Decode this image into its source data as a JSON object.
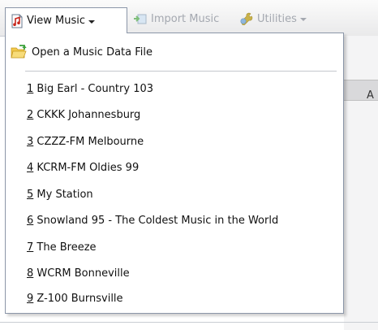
{
  "toolbar": {
    "view_music_label": "View Music",
    "import_music_label": "Import Music",
    "utilities_label": "Utilities"
  },
  "menu": {
    "open_file_label": "Open a Music Data File",
    "stations": [
      {
        "num": "1",
        "name": " Big Earl - Country 103"
      },
      {
        "num": "2",
        "name": " CKKK Johannesburg"
      },
      {
        "num": "3",
        "name": " CZZZ-FM Melbourne"
      },
      {
        "num": "4",
        "name": " KCRM-FM Oldies 99"
      },
      {
        "num": "5",
        "name": " My Station"
      },
      {
        "num": "6",
        "name": " Snowland 95 - The Coldest Music in the World"
      },
      {
        "num": "7",
        "name": " The Breeze"
      },
      {
        "num": "8",
        "name": " WCRM Bonneville"
      },
      {
        "num": "9",
        "name": " Z-100 Burnsville"
      }
    ]
  },
  "background": {
    "partial_text": "A"
  },
  "icons": {
    "view_music": "music-note-document-icon",
    "import_music": "import-arrow-icon",
    "utilities": "utilities-icon",
    "open_file": "open-folder-icon"
  }
}
